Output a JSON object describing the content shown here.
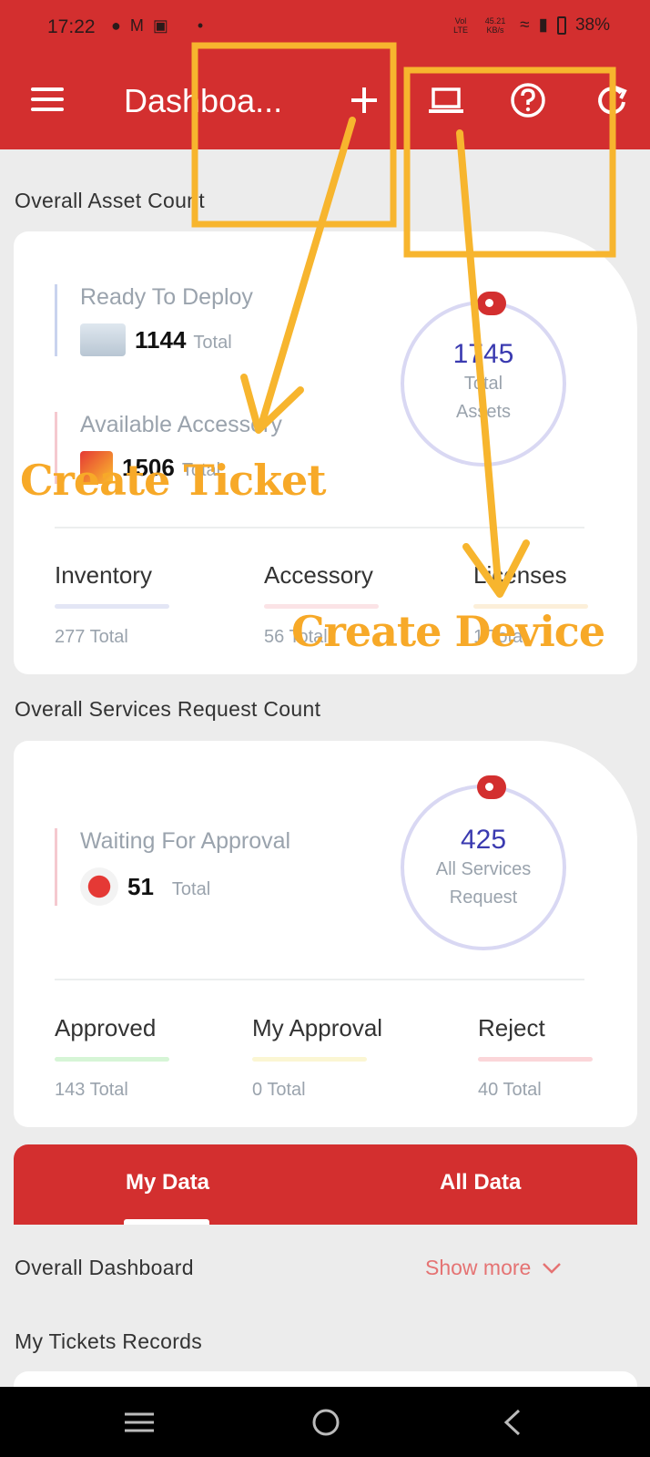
{
  "status_bar": {
    "time": "17:22",
    "lte_label": "Vol LTE",
    "speed": "45.21 KB/s",
    "battery": "38%"
  },
  "app_bar": {
    "title": "Dashboa..."
  },
  "asset_section": {
    "title": "Overall Asset Count",
    "ready": {
      "label": "Ready To Deploy",
      "count": "1144",
      "unit": "Total"
    },
    "accessory_available": {
      "label": "Available Accessory",
      "count": "1506",
      "unit": "Total"
    },
    "circle": {
      "count": "1745",
      "caption_1": "Total",
      "caption_2": "Assets"
    },
    "stats": [
      {
        "name": "Inventory",
        "total": "277 Total",
        "color": "#e3e6f5"
      },
      {
        "name": "Accessory",
        "total": "56 Total",
        "color": "#fbe3e6"
      },
      {
        "name": "Licenses",
        "total": "1 Total",
        "color": "#fcefd9"
      }
    ]
  },
  "service_section": {
    "title": "Overall Services Request Count",
    "waiting": {
      "label": "Waiting For Approval",
      "count": "51",
      "unit": "Total"
    },
    "circle": {
      "count": "425",
      "caption_1": "All Services",
      "caption_2": "Request"
    },
    "stats": [
      {
        "name": "Approved",
        "total": "143 Total",
        "color": "#d6f5d6"
      },
      {
        "name": "My Approval",
        "total": "0 Total",
        "color": "#fbf6d3"
      },
      {
        "name": "Reject",
        "total": "40 Total",
        "color": "#fbd6d9"
      }
    ]
  },
  "tabs": {
    "my_data": "My Data",
    "all_data": "All Data"
  },
  "dashboard": {
    "title": "Overall Dashboard",
    "show_more": "Show more"
  },
  "records": {
    "title": "My Tickets Records"
  },
  "annotations": {
    "create_ticket": "Create Ticket",
    "create_device": "Create Device"
  },
  "colors": {
    "brand": "#d32f2f",
    "annotation": "#f7a928"
  }
}
